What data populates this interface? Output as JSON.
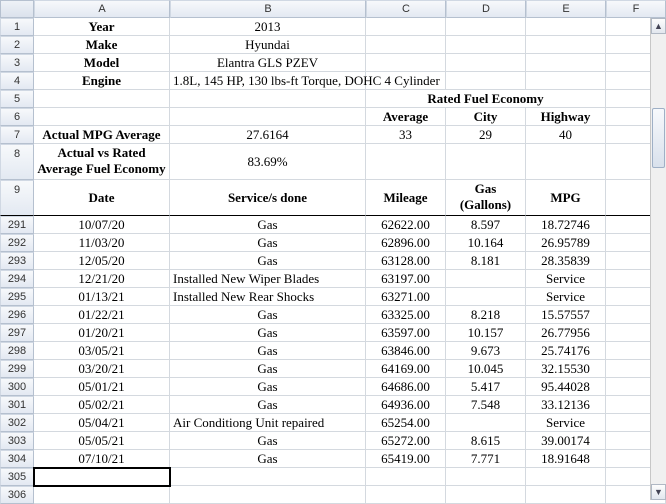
{
  "columns": [
    "A",
    "B",
    "C",
    "D",
    "E",
    "F"
  ],
  "header_rows": [
    "1",
    "2",
    "3",
    "4",
    "5",
    "6",
    "7",
    "8",
    "9"
  ],
  "info": {
    "year_label": "Year",
    "year_value": "2013",
    "make_label": "Make",
    "make_value": "Hyundai",
    "model_label": "Model",
    "model_value": "Elantra GLS PZEV",
    "engine_label": "Engine",
    "engine_value": "1.8L, 145 HP, 130 lbs-ft Torque, DOHC 4 Cylinder"
  },
  "rated": {
    "title": "Rated Fuel Economy",
    "avg_label": "Average",
    "city_label": "City",
    "hwy_label": "Highway",
    "avg": "33",
    "city": "29",
    "hwy": "40"
  },
  "actual": {
    "mpg_label": "Actual MPG Average",
    "mpg_value": "27.6164",
    "ratio_label_1": "Actual vs Rated",
    "ratio_label_2": "Average Fuel Economy",
    "ratio_value": "83.69%"
  },
  "data_header": {
    "date": "Date",
    "service": "Service/s done",
    "mileage": "Mileage",
    "gas1": "Gas",
    "gas2": "(Gallons)",
    "mpg": "MPG"
  },
  "rows": [
    {
      "n": "291",
      "date": "10/07/20",
      "service": "Gas",
      "mileage": "62622.00",
      "gallons": "8.597",
      "mpg": "18.72746"
    },
    {
      "n": "292",
      "date": "11/03/20",
      "service": "Gas",
      "mileage": "62896.00",
      "gallons": "10.164",
      "mpg": "26.95789"
    },
    {
      "n": "293",
      "date": "12/05/20",
      "service": "Gas",
      "mileage": "63128.00",
      "gallons": "8.181",
      "mpg": "28.35839"
    },
    {
      "n": "294",
      "date": "12/21/20",
      "service": "Installed New Wiper Blades",
      "mileage": "63197.00",
      "gallons": "",
      "mpg": "Service"
    },
    {
      "n": "295",
      "date": "01/13/21",
      "service": "Installed New Rear Shocks",
      "mileage": "63271.00",
      "gallons": "",
      "mpg": "Service"
    },
    {
      "n": "296",
      "date": "01/22/21",
      "service": "Gas",
      "mileage": "63325.00",
      "gallons": "8.218",
      "mpg": "15.57557"
    },
    {
      "n": "297",
      "date": "01/20/21",
      "service": "Gas",
      "mileage": "63597.00",
      "gallons": "10.157",
      "mpg": "26.77956"
    },
    {
      "n": "298",
      "date": "03/05/21",
      "service": "Gas",
      "mileage": "63846.00",
      "gallons": "9.673",
      "mpg": "25.74176"
    },
    {
      "n": "299",
      "date": "03/20/21",
      "service": "Gas",
      "mileage": "64169.00",
      "gallons": "10.045",
      "mpg": "32.15530"
    },
    {
      "n": "300",
      "date": "05/01/21",
      "service": "Gas",
      "mileage": "64686.00",
      "gallons": "5.417",
      "mpg": "95.44028"
    },
    {
      "n": "301",
      "date": "05/02/21",
      "service": "Gas",
      "mileage": "64936.00",
      "gallons": "7.548",
      "mpg": "33.12136"
    },
    {
      "n": "302",
      "date": "05/04/21",
      "service": "Air Conditiong Unit repaired",
      "mileage": "65254.00",
      "gallons": "",
      "mpg": "Service"
    },
    {
      "n": "303",
      "date": "05/05/21",
      "service": "Gas",
      "mileage": "65272.00",
      "gallons": "8.615",
      "mpg": "39.00174"
    },
    {
      "n": "304",
      "date": "07/10/21",
      "service": "Gas",
      "mileage": "65419.00",
      "gallons": "7.771",
      "mpg": "18.91648"
    }
  ],
  "trailing_rows": [
    "305",
    "306"
  ],
  "chart_data": {
    "type": "table",
    "title": "Vehicle Fuel & Service Log",
    "vehicle": {
      "year": 2013,
      "make": "Hyundai",
      "model": "Elantra GLS PZEV",
      "engine": "1.8L, 145 HP, 130 lbs-ft Torque, DOHC 4 Cylinder"
    },
    "rated_fuel_economy": {
      "average": 33,
      "city": 29,
      "highway": 40
    },
    "actual_mpg_average": 27.6164,
    "actual_vs_rated_pct": 83.69,
    "columns": [
      "Date",
      "Service/s done",
      "Mileage",
      "Gas (Gallons)",
      "MPG"
    ],
    "records": [
      [
        "10/07/20",
        "Gas",
        62622.0,
        8.597,
        18.72746
      ],
      [
        "11/03/20",
        "Gas",
        62896.0,
        10.164,
        26.95789
      ],
      [
        "12/05/20",
        "Gas",
        63128.0,
        8.181,
        28.35839
      ],
      [
        "12/21/20",
        "Installed New Wiper Blades",
        63197.0,
        null,
        "Service"
      ],
      [
        "01/13/21",
        "Installed New Rear Shocks",
        63271.0,
        null,
        "Service"
      ],
      [
        "01/22/21",
        "Gas",
        63325.0,
        8.218,
        15.57557
      ],
      [
        "01/20/21",
        "Gas",
        63597.0,
        10.157,
        26.77956
      ],
      [
        "03/05/21",
        "Gas",
        63846.0,
        9.673,
        25.74176
      ],
      [
        "03/20/21",
        "Gas",
        64169.0,
        10.045,
        32.1553
      ],
      [
        "05/01/21",
        "Gas",
        64686.0,
        5.417,
        95.44028
      ],
      [
        "05/02/21",
        "Gas",
        64936.0,
        7.548,
        33.12136
      ],
      [
        "05/04/21",
        "Air Conditiong Unit repaired",
        65254.0,
        null,
        "Service"
      ],
      [
        "05/05/21",
        "Gas",
        65272.0,
        8.615,
        39.00174
      ],
      [
        "07/10/21",
        "Gas",
        65419.0,
        7.771,
        18.91648
      ]
    ]
  }
}
